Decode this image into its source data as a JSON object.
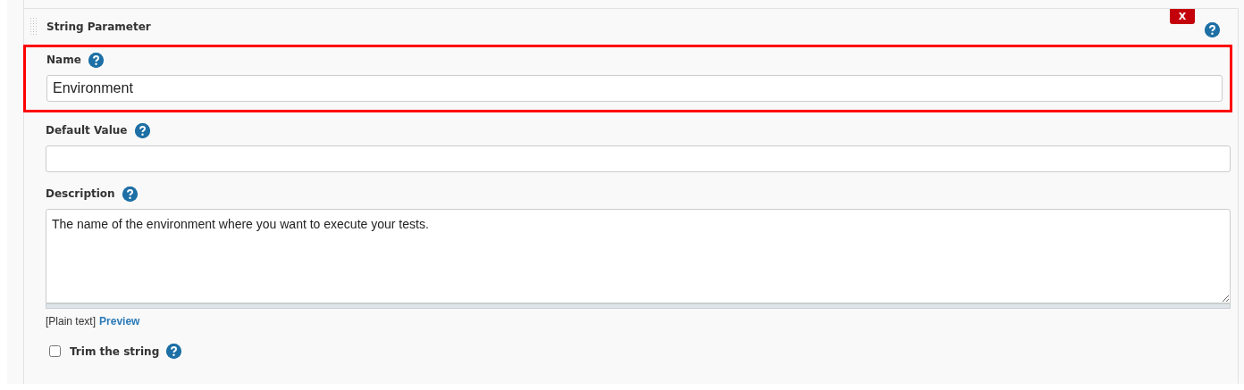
{
  "parameter": {
    "title": "String Parameter",
    "delete_label": "X"
  },
  "name_field": {
    "label": "Name",
    "value": "Environment",
    "highlighted": true
  },
  "default_value_field": {
    "label": "Default Value"
  },
  "description_field": {
    "label": "Description",
    "value": "The name of the environment where you want to execute your tests."
  },
  "format": {
    "syntax": "[Plain text]",
    "preview_link": "Preview"
  },
  "trim": {
    "label": "Trim the string",
    "checked": false
  }
}
